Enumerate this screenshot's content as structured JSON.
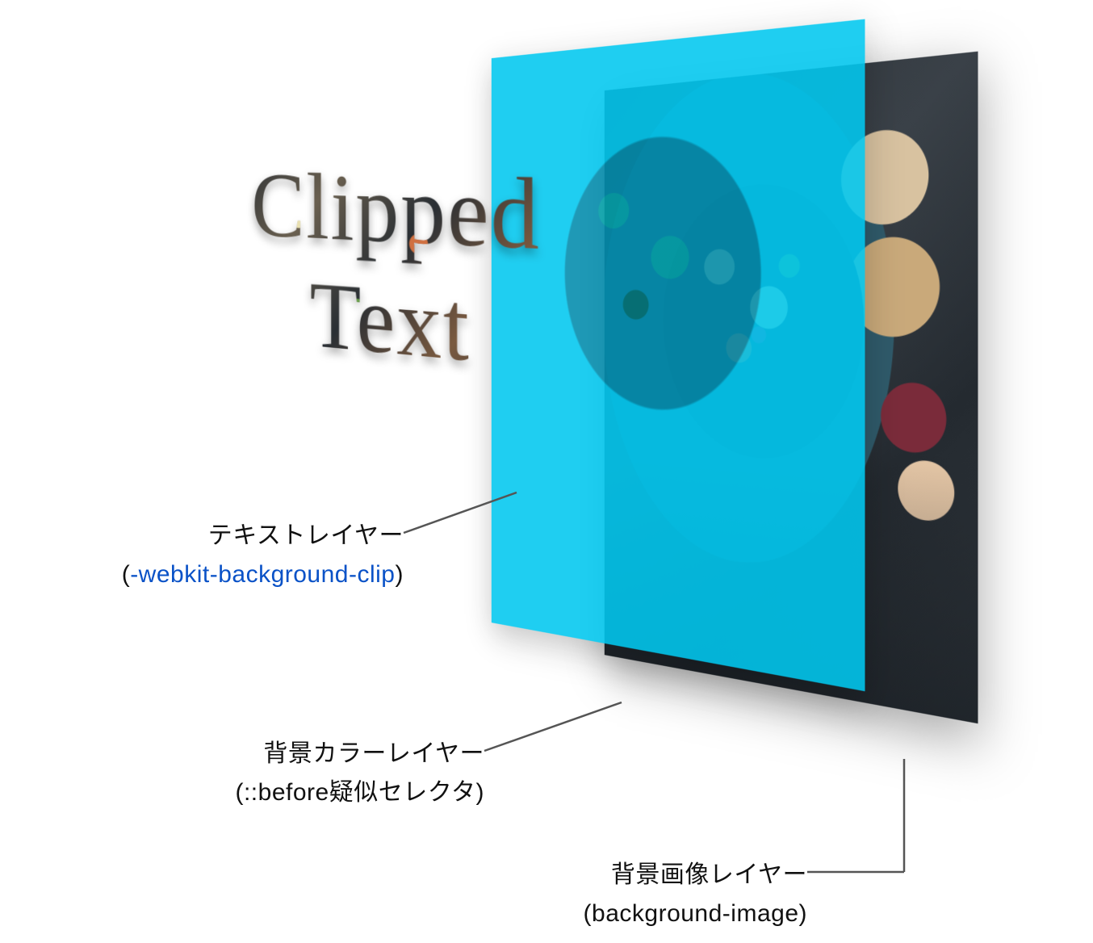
{
  "clipped_text": "Clipped\nText",
  "labels": {
    "text_layer": {
      "line1": "テキストレイヤー",
      "paren_open": "(",
      "css_prop": "-webkit-background-clip",
      "paren_close": ")"
    },
    "color_layer": {
      "line1": "背景カラーレイヤー",
      "line2": "(::before疑似セレクタ)"
    },
    "image_layer": {
      "line1": "背景画像レイヤー",
      "line2": "(background-image)"
    }
  },
  "colors": {
    "cyan_overlay": "#00c8f0",
    "link_blue": "#0a52c7"
  }
}
